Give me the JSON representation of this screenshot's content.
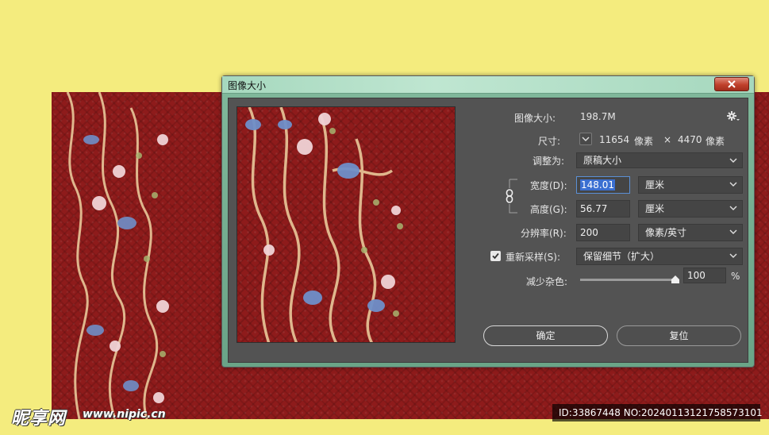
{
  "background": {
    "desktop_color": "#f4ec7e",
    "document_color": "#8e1b1b"
  },
  "dialog": {
    "title": "图像大小",
    "close_icon": "close-icon",
    "image_size_label": "图像大小:",
    "image_size_value": "198.7M",
    "settings_icon": "gear-icon",
    "dimensions_label": "尺寸:",
    "dimensions_width": "11654",
    "dimensions_width_unit": "像素",
    "dimensions_times": "×",
    "dimensions_height": "4470",
    "dimensions_height_unit": "像素",
    "fit_to_label": "调整为:",
    "fit_to_value": "原稿大小",
    "width_label": "宽度(D):",
    "width_value": "148.01",
    "width_unit": "厘米",
    "height_label": "高度(G):",
    "height_value": "56.77",
    "height_unit": "厘米",
    "resolution_label": "分辨率(R):",
    "resolution_value": "200",
    "resolution_unit": "像素/英寸",
    "resample_label": "重新采样(S):",
    "resample_checked": true,
    "resample_value": "保留细节（扩大）",
    "reduce_noise_label": "减少杂色:",
    "reduce_noise_value": "100",
    "reduce_noise_level": 1.0,
    "reduce_noise_unit": "%",
    "ok_label": "确定",
    "reset_label": "复位",
    "accent_color": "#3b6fd1"
  },
  "watermark": {
    "logo_text": "昵享网",
    "url_text": "www.nipic.cn",
    "id_text": "ID:33867448 NO:20240113121758573101"
  }
}
